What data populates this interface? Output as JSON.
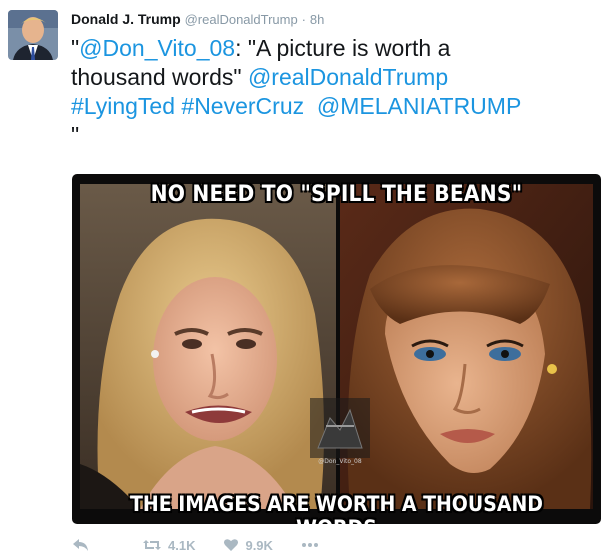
{
  "tweet": {
    "author_name": "Donald J. Trump",
    "author_handle": "@realDonaldTrump",
    "separator": "·",
    "timestamp": "8h",
    "text": {
      "line1_quote_open": "\"",
      "line1_mention": "@Don_Vito_08",
      "line1_rest": ": \"A picture is worth a",
      "line2_text": "thousand words\" ",
      "line2_mention": "@realDonaldTrump",
      "line3_hashtag1": "#LyingTed",
      "line3_hashtag2": "#NeverCruz",
      "line3_mention": "@MELANIATRUMP",
      "line4_text": "\""
    },
    "media": {
      "top_caption": "NO NEED TO \"SPILL THE BEANS\"",
      "bottom_caption": "THE IMAGES ARE WORTH A THOUSAND WORDS",
      "watermark_text": "@Don_Vito_08"
    },
    "actions": {
      "reply_icon": "reply-icon",
      "retweet_icon": "retweet-icon",
      "retweet_count": "4.1K",
      "like_icon": "heart-icon",
      "like_count": "9.9K",
      "more_icon": "more-dots-icon"
    }
  },
  "colors": {
    "link": "#1b95e0",
    "muted": "#8899a6",
    "action_gray": "#aab8c2",
    "text": "#14171a"
  }
}
